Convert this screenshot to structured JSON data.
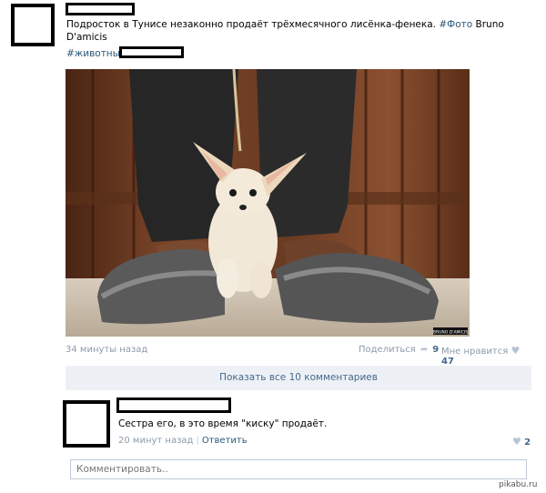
{
  "post": {
    "text_main": "Подросток в Тунисе незаконно продаёт трёхмесячного лисёнка-фенека.",
    "photo_tag": "#Фото",
    "photo_author": "Bruno D'amicis",
    "hashtag": "#животные",
    "photo_credit": "BRUNO D'AMICIS",
    "time": "34 минуты назад",
    "share_label": "Поделиться",
    "share_count": "9",
    "like_label": "Мне нравится",
    "like_count": "47"
  },
  "comments": {
    "show_all_label": "Показать все 10 комментариев",
    "items": [
      {
        "text": "Сестра его, в это время \"киску\" продаёт.",
        "time": "20 минут назад",
        "reply_label": "Ответить",
        "like_count": "2"
      }
    ],
    "input_placeholder": "Комментировать.."
  },
  "watermark": "pikabu.ru",
  "icons": {
    "share": "share-arrow-icon",
    "like": "heart-icon"
  },
  "colors": {
    "link": "#2b587a",
    "muted": "#8c9bab",
    "show_all_bg": "#edf1f5"
  }
}
